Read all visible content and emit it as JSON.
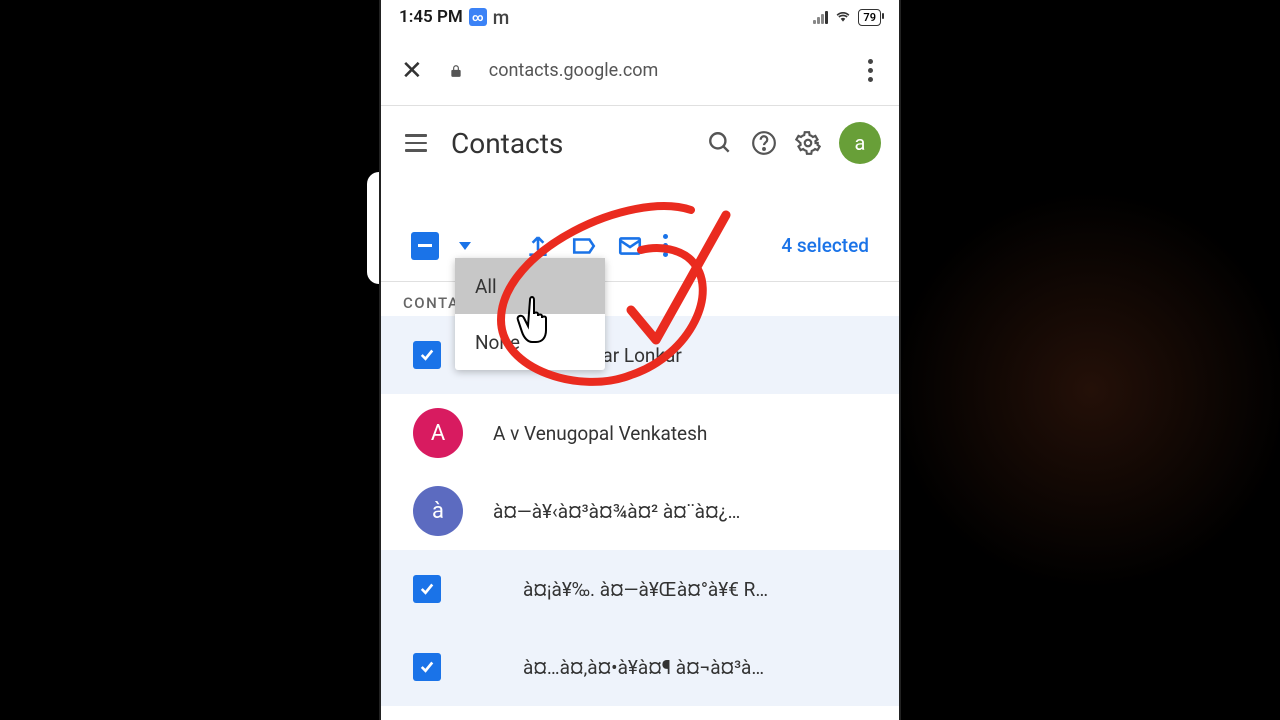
{
  "status": {
    "time": "1:45 PM",
    "battery": "79"
  },
  "browser": {
    "url": "contacts.google.com"
  },
  "header": {
    "title": "Contacts",
    "avatar_letter": "a"
  },
  "selection": {
    "count_text": "4 selected"
  },
  "dropdown": {
    "all": "All",
    "none": "None"
  },
  "section_label": "CONTACTS",
  "contacts": [
    {
      "name": "Shkar Lonkar",
      "selected": true,
      "avatar": "",
      "color": ""
    },
    {
      "name": "A v Venugopal Venkatesh",
      "selected": false,
      "avatar": "A",
      "color": "#d81b60"
    },
    {
      "name": "à¤—à¥‹à¤³à¤¾à¤² à¤¨à¤¿…",
      "selected": false,
      "avatar": "à",
      "color": "#5c6bc0"
    },
    {
      "name": "à¤¡à¥‰. à¤—à¥Œà¤°à¥€ R…",
      "selected": true,
      "avatar": "",
      "color": ""
    },
    {
      "name": "à¤…à¤‚à¤•à¥à¤¶ à¤¬à¤³à…",
      "selected": true,
      "avatar": "",
      "color": ""
    }
  ]
}
